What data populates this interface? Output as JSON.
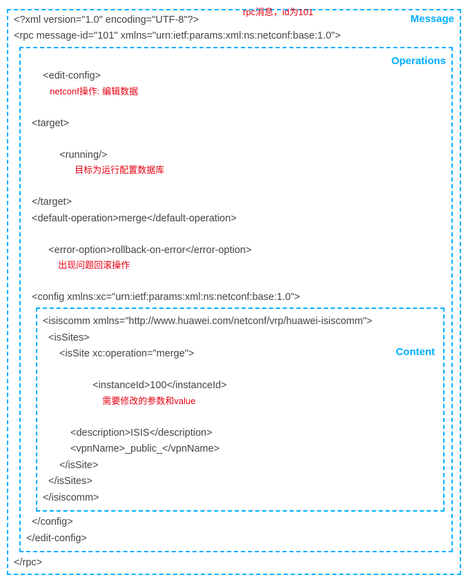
{
  "labels": {
    "message": "Message",
    "operations": "Operations",
    "content": "Content"
  },
  "annotations": {
    "rpc_msg": "rpc消息，id为101",
    "netconf_op": "netconf操作: 编辑数据",
    "target_db": "目标为运行配置数据库",
    "error_opt": "出现问题回滚操作",
    "param_value": "需要修改的参数和value"
  },
  "xml": {
    "declaration": "<?xml version=\"1.0\" encoding=\"UTF-8\"?>",
    "rpc_open": "<rpc message-id=\"101\" xmlns=\"urn:ietf:params:xml:ns:netconf:base:1.0\">",
    "edit_config_open": "<edit-config>",
    "target_open": "<target>",
    "running": "<running/>",
    "target_close": "</target>",
    "default_operation": "<default-operation>merge</default-operation>",
    "error_option": "<error-option>rollback-on-error</error-option>",
    "config_open": "<config xmlns:xc=\"urn:ietf:params:xml:ns:netconf:base:1.0\">",
    "isiscomm_open": "<isiscomm xmlns=\"http://www.huawei.com/netconf/vrp/huawei-isiscomm\">",
    "issites_open": "<isSites>",
    "issite_open": "<isSite xc:operation=\"merge\">",
    "instanceid": "<instanceId>100</instanceId>",
    "description": "<description>ISIS</description>",
    "vpnname": "<vpnName>_public_</vpnName>",
    "issite_close": "</isSite>",
    "issites_close": "</isSites>",
    "isiscomm_close": "</isiscomm>",
    "config_close": "</config>",
    "edit_config_close": "</edit-config>",
    "rpc_close": "</rpc>"
  }
}
